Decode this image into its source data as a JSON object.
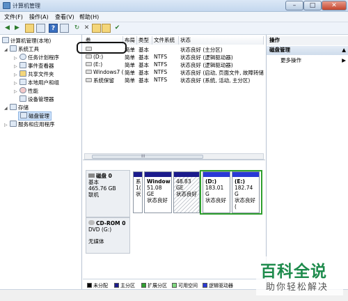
{
  "window": {
    "title": "计算机管理",
    "min": "–",
    "max": "□",
    "close": "✕"
  },
  "menu": [
    "文件(F)",
    "操作(A)",
    "查看(V)",
    "帮助(H)"
  ],
  "toolbar_icons": [
    "back-icon",
    "forward-icon",
    "up-folder-icon",
    "console-tree-icon",
    "help-icon",
    "properties-icon",
    "refresh-icon",
    "delete-icon",
    "folder-icon",
    "open-icon",
    "check-icon"
  ],
  "tree": {
    "root": "计算机管理(本地)",
    "system_tools": "系统工具",
    "task_scheduler": "任务计划程序",
    "event_viewer": "事件查看器",
    "shared_folders": "共享文件夹",
    "local_users": "本地用户和组",
    "performance": "性能",
    "device_manager": "设备管理器",
    "storage": "存储",
    "disk_management": "磁盘管理",
    "services_apps": "服务和应用程序"
  },
  "volumes": {
    "headers": [
      "卷",
      "布局",
      "类型",
      "文件系统",
      "状态"
    ],
    "rows": [
      {
        "vol": "",
        "layout": "简单",
        "type": "基本",
        "fs": "",
        "status": "状态良好 (主分区)"
      },
      {
        "vol": "(D:)",
        "layout": "简单",
        "type": "基本",
        "fs": "NTFS",
        "status": "状态良好 (逻辑驱动器)"
      },
      {
        "vol": "(E:)",
        "layout": "简单",
        "type": "基本",
        "fs": "NTFS",
        "status": "状态良好 (逻辑驱动器)"
      },
      {
        "vol": "Windows7 (C:)",
        "layout": "简单",
        "type": "基本",
        "fs": "NTFS",
        "status": "状态良好 (启动, 页面文件, 故障转储, 主分区)"
      },
      {
        "vol": "系统保留",
        "layout": "简单",
        "type": "基本",
        "fs": "NTFS",
        "status": "状态良好 (系统, 活动, 主分区)"
      }
    ],
    "scroll_glyph": "III"
  },
  "disk0": {
    "name": "磁盘 0",
    "type": "基本",
    "size": "465.76 GB",
    "state": "联机",
    "partitions": [
      {
        "l1": "系",
        "l2": "1(",
        "l3": "状"
      },
      {
        "l1": "Window",
        "l2": "51.08 GE",
        "l3": "状态良好"
      },
      {
        "l1": "",
        "l2": "48.83 GE",
        "l3": "状态良好"
      },
      {
        "l1": "(D:)",
        "l2": "183.01 G",
        "l3": "状态良好"
      },
      {
        "l1": "(E:)",
        "l2": "182.74 G",
        "l3": "状态良好 ("
      }
    ]
  },
  "cdrom": {
    "name": "CD-ROM 0",
    "type": "DVD (G:)",
    "media": "无媒体"
  },
  "legend": [
    "未分配",
    "主分区",
    "扩展分区",
    "可用空间",
    "逻辑驱动器"
  ],
  "colors": {
    "unalloc": "#000000",
    "primary": "#1b1b8c",
    "extended": "#2fa02f",
    "free": "#7fd97f",
    "logical": "#2a39d6"
  },
  "actions": {
    "header": "操作",
    "section": "磁盘管理",
    "more": "更多操作"
  },
  "watermark": {
    "big": "百科全说",
    "small": "助你轻松解决"
  }
}
